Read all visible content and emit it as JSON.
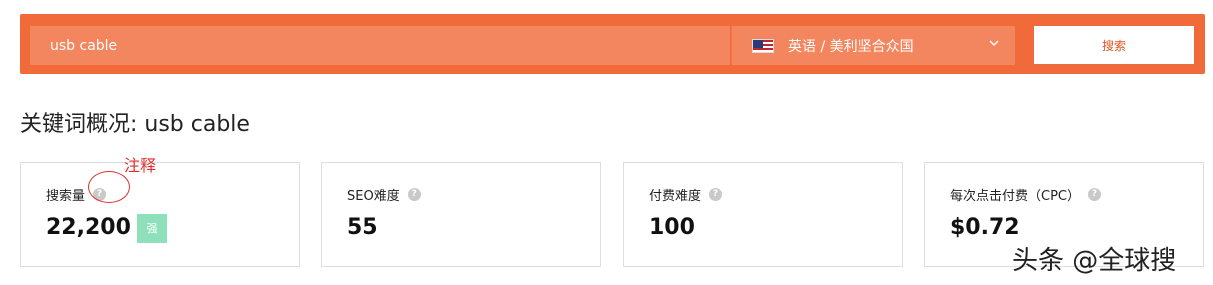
{
  "search": {
    "query": "usb cable",
    "language_region": "英语 / 美利坚合众国",
    "button_label": "搜索"
  },
  "title": "关键词概况: usb cable",
  "metrics": [
    {
      "label": "搜索量",
      "value": "22,200",
      "badge": "强"
    },
    {
      "label": "SEO难度",
      "value": "55"
    },
    {
      "label": "付费难度",
      "value": "100"
    },
    {
      "label": "每次点击付费（CPC）",
      "value": "$0.72"
    }
  ],
  "annotation": "注释",
  "watermark": "头条 @全球搜",
  "help_icon_glyph": "?",
  "colors": {
    "brand": "#f06a3a",
    "badge": "#8ee0ba",
    "annotation": "#e03030"
  }
}
